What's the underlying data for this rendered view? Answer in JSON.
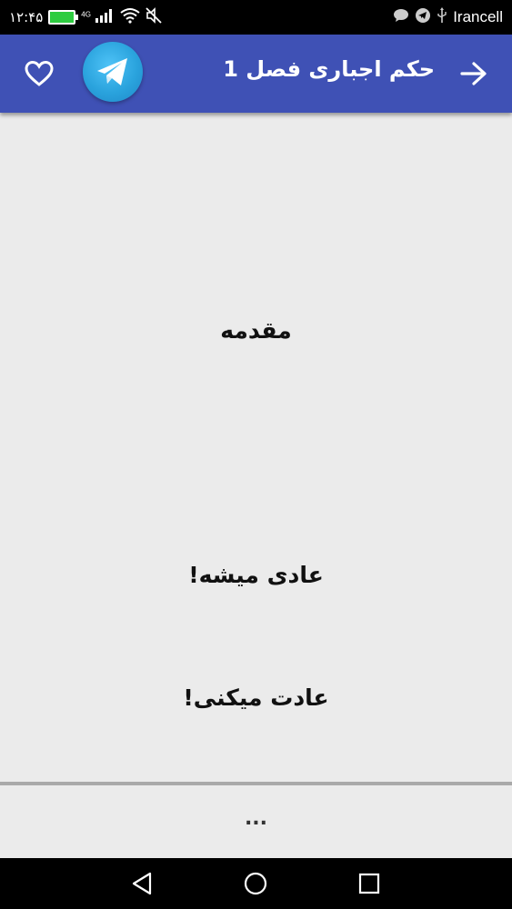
{
  "status_bar": {
    "time": "۱۲:۴۵",
    "network_badge": "4G",
    "carrier": "Irancell",
    "battery_color": "#2ecc40"
  },
  "app_bar": {
    "title": "حکم اجباری فصل 1",
    "background_color": "#3f51b5",
    "back_icon": "arrow-right-icon",
    "telegram_icon": "telegram-icon",
    "favorite_icon": "heart-outline-icon"
  },
  "content": {
    "background_color": "#ebebeb",
    "lines": [
      "مقدمه",
      "عادی میشه!",
      "عادت میکنی!"
    ],
    "next_partial": "..."
  },
  "nav_bar": {
    "back_icon": "triangle-back-icon",
    "home_icon": "circle-home-icon",
    "recents_icon": "square-recents-icon"
  }
}
